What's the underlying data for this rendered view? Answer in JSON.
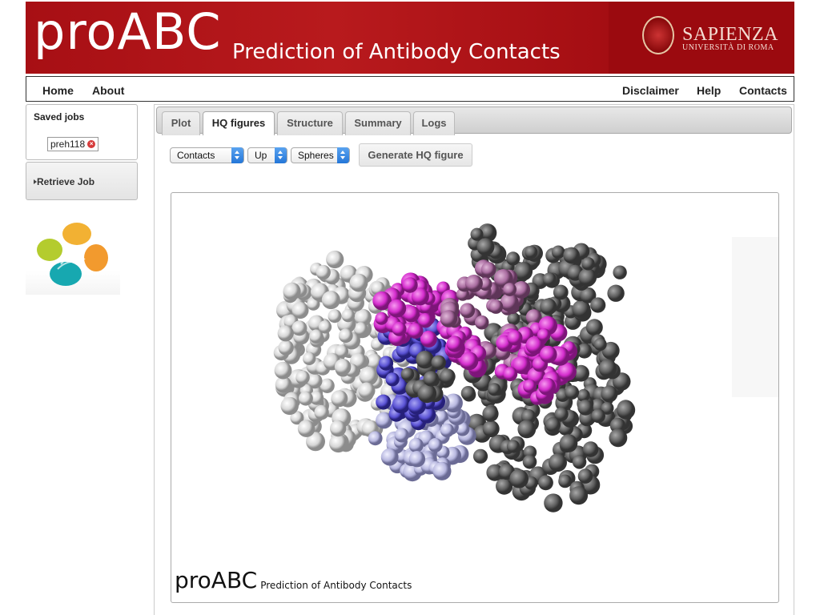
{
  "banner": {
    "title": "proABC",
    "subtitle": "Prediction of Antibody Contacts",
    "university_name": "SAPIENZA",
    "university_sub": "UNIVERSITÀ DI ROMA"
  },
  "nav": {
    "left": [
      "Home",
      "About"
    ],
    "right": [
      "Disclaimer",
      "Help",
      "Contacts"
    ]
  },
  "sidebar": {
    "saved_jobs_title": "Saved jobs",
    "jobs": [
      {
        "name": "preh118"
      }
    ],
    "retrieve_label": "Retrieve Job"
  },
  "tabs": [
    {
      "label": "Plot",
      "active": false
    },
    {
      "label": "HQ figures",
      "active": true
    },
    {
      "label": "Structure",
      "active": false
    },
    {
      "label": "Summary",
      "active": false
    },
    {
      "label": "Logs",
      "active": false
    }
  ],
  "controls": {
    "selects": [
      "Contacts",
      "Up",
      "Spheres"
    ],
    "generate_label": "Generate HQ figure"
  },
  "figure": {
    "caption_title": "proABC",
    "caption_subtitle": "Prediction of Antibody Contacts"
  },
  "colors": {
    "banner_red": "#a70f14",
    "contact_magenta": "#d72fd2",
    "contact_blue": "#5a52d4",
    "chain_gray": "#6a6a6a",
    "chain_white": "#e2e2e2"
  }
}
